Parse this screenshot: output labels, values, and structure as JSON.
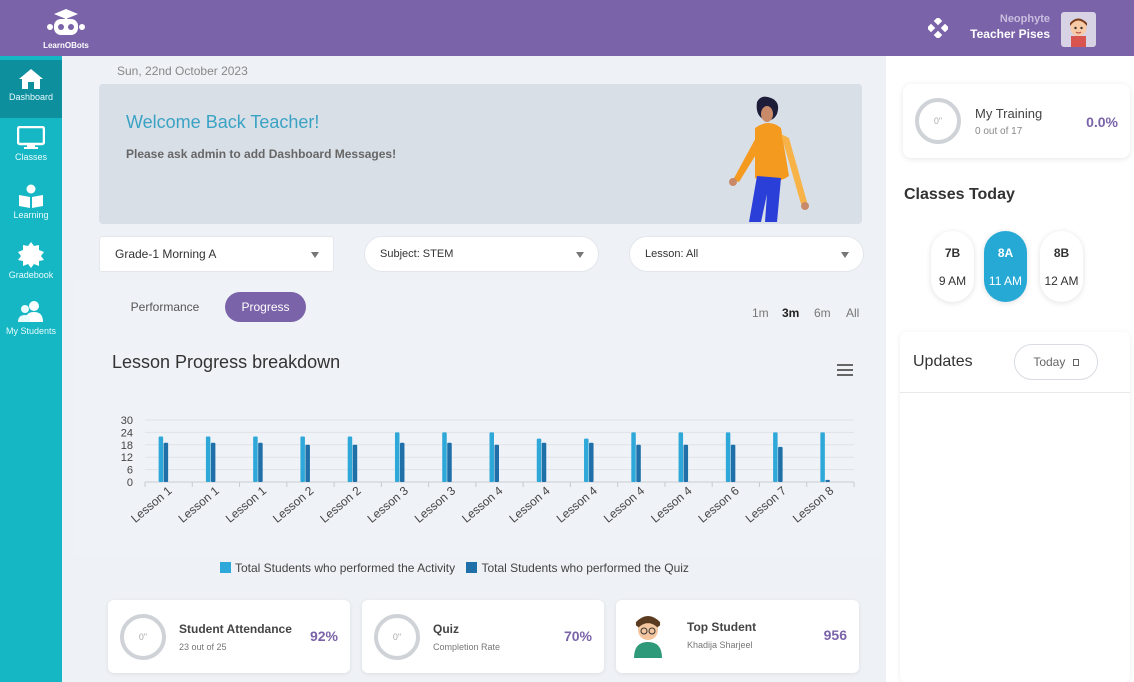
{
  "app": {
    "logo_text": "LearnOBots"
  },
  "user": {
    "level": "Neophyte",
    "name": "Teacher Pises"
  },
  "sidebar": {
    "items": [
      {
        "label": "Dashboard",
        "icon": "home-icon",
        "active": true
      },
      {
        "label": "Classes",
        "icon": "monitor-icon"
      },
      {
        "label": "Learning",
        "icon": "book-reader-icon"
      },
      {
        "label": "Gradebook",
        "icon": "badge-icon"
      },
      {
        "label": "My Students",
        "icon": "users-icon"
      }
    ]
  },
  "main": {
    "date": "Sun, 22nd October 2023",
    "welcome": {
      "title": "Welcome Back Teacher!",
      "message": "Please ask admin to add Dashboard Messages!"
    },
    "filters": {
      "grade": "Grade-1 Morning A",
      "subject": "Subject: STEM",
      "lesson": "Lesson: All"
    },
    "tabs": {
      "performance": "Performance",
      "progress": "Progress"
    },
    "ranges": [
      "1m",
      "3m",
      "6m",
      "All"
    ],
    "active_range": "3m",
    "chart_title": "Lesson Progress breakdown",
    "stats": {
      "attendance": {
        "ring": "0\"",
        "title": "Student Attendance",
        "sub": "23 out of 25",
        "value": "92%"
      },
      "quiz": {
        "ring": "0\"",
        "title": "Quiz",
        "sub": "Completion Rate",
        "value": "70%"
      },
      "top_student": {
        "title": "Top Student",
        "sub": "Khadija Sharjeel",
        "value": "956"
      }
    }
  },
  "right": {
    "training": {
      "ring": "0\"",
      "title": "My Training",
      "sub": "0 out of 17",
      "value": "0.0%"
    },
    "classes_title": "Classes Today",
    "classes": [
      {
        "code": "7B",
        "time": "9 AM",
        "active": false
      },
      {
        "code": "8A",
        "time": "11 AM",
        "active": true
      },
      {
        "code": "8B",
        "time": "12 AM",
        "active": false
      }
    ],
    "updates_title": "Updates",
    "updates_filter": "Today"
  },
  "colors": {
    "brand": "#7a63a8",
    "sidebar": "#16b7c4",
    "series_activity": "#2ea8d8",
    "series_quiz": "#1f6fa8"
  },
  "chart_data": {
    "type": "bar",
    "title": "Lesson Progress breakdown",
    "categories": [
      "Lesson 1",
      "Lesson 1",
      "Lesson 1",
      "Lesson 2",
      "Lesson 2",
      "Lesson 3",
      "Lesson 3",
      "Lesson 4",
      "Lesson 4",
      "Lesson 4",
      "Lesson 4",
      "Lesson 4",
      "Lesson 6",
      "Lesson 7",
      "Lesson 8"
    ],
    "series": [
      {
        "name": "Total Students who performed the Activity",
        "values": [
          22,
          22,
          22,
          22,
          22,
          24,
          24,
          24,
          21,
          21,
          24,
          24,
          24,
          24,
          24
        ]
      },
      {
        "name": "Total Students who performed the Quiz",
        "values": [
          19,
          19,
          19,
          18,
          18,
          19,
          19,
          18,
          19,
          19,
          18,
          18,
          18,
          17,
          1
        ]
      }
    ],
    "yticks": [
      0,
      6,
      12,
      18,
      24,
      30
    ],
    "ylim": [
      0,
      30
    ],
    "legend": "bottom"
  }
}
